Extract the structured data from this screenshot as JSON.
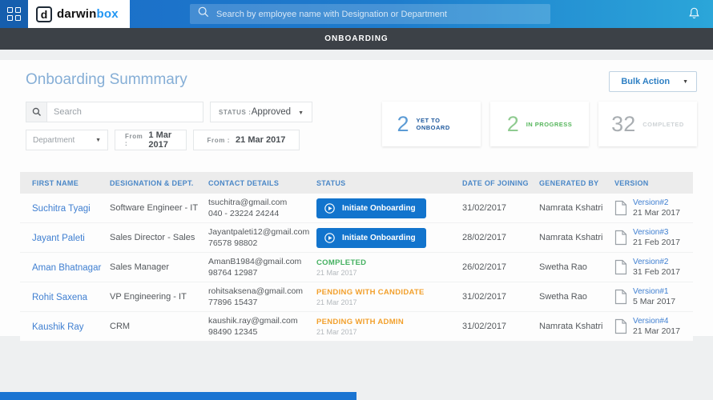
{
  "navbar": {
    "brand_darwin": "darwin",
    "brand_box": "box",
    "brand_initial": "d",
    "search_placeholder": "Search by employee name with Designation or Department"
  },
  "tabbar": {
    "title": "ONBOARDING"
  },
  "page": {
    "title": "Onboarding Summmary",
    "bulk_action_label": "Bulk Action"
  },
  "filters": {
    "search_placeholder": "Search",
    "status_label": "STATUS :",
    "status_value": "Approved",
    "department_placeholder": "Department",
    "from_label": "From :",
    "from_value": "1 Mar 2017",
    "to_label": "From :",
    "to_value": "21 Mar 2017"
  },
  "stats": [
    {
      "value": "2",
      "label": "YET TO ONBOARD",
      "color": "#5b9bd5"
    },
    {
      "value": "2",
      "label": "IN PROGRESS",
      "color": "#8fcb90"
    },
    {
      "value": "32",
      "label": "COMPLETED",
      "color": "#a9aeb2"
    }
  ],
  "table": {
    "headers": [
      "FIRST NAME",
      "DESIGNATION & DEPT.",
      "CONTACT DETAILS",
      "STATUS",
      "DATE OF JOINING",
      "GENERATED BY",
      "VERSION"
    ],
    "status_colors": {
      "completed": "#45b161",
      "pending": "#f2a02c",
      "button": "#1274cd"
    },
    "rows": [
      {
        "name": "Suchitra Tyagi",
        "designation": "Software Engineer - IT",
        "contact_line1": "tsuchitra@gmail.com",
        "contact_line2": "040 - 23224 24244",
        "status_type": "button",
        "status_label": "Initiate Onboarding",
        "doj": "31/02/2017",
        "generated_by": "Namrata Kshatri",
        "version": "Version#2",
        "version_date": "21 Mar 2017"
      },
      {
        "name": "Jayant Paleti",
        "designation": "Sales Director - Sales",
        "contact_line1": "Jayantpaleti12@gmail.com",
        "contact_line2": "76578 98802",
        "status_type": "button",
        "status_label": "Initiate Onboarding",
        "doj": "28/02/2017",
        "generated_by": "Namrata Kshatri",
        "version": "Version#3",
        "version_date": "21 Feb 2017"
      },
      {
        "name": "Aman Bhatnagar",
        "designation": "Sales Manager",
        "contact_line1": "AmanB1984@gmail.com",
        "contact_line2": "98764 12987",
        "status_type": "text",
        "status_label": "COMPLETED",
        "status_color": "#45b161",
        "status_date": "21 Mar 2017",
        "doj": "26/02/2017",
        "generated_by": "Swetha Rao",
        "version": "Version#2",
        "version_date": "31 Feb 2017"
      },
      {
        "name": "Rohit Saxena",
        "designation": "VP Engineering - IT",
        "contact_line1": "rohitsaksena@gmail.com",
        "contact_line2": "77896 15437",
        "status_type": "text",
        "status_label": "PENDING WITH CANDIDATE",
        "status_color": "#f2a02c",
        "status_date": "21 Mar 2017",
        "doj": "31/02/2017",
        "generated_by": "Swetha Rao",
        "version": "Version#1",
        "version_date": "5 Mar 2017"
      },
      {
        "name": "Kaushik Ray",
        "designation": "CRM",
        "contact_line1": "kaushik.ray@gmail.com",
        "contact_line2": "98490 12345",
        "status_type": "text",
        "status_label": "PENDING WITH ADMIN",
        "status_color": "#f2a02c",
        "status_date": "21 Mar 2017",
        "doj": "31/02/2017",
        "generated_by": "Namrata Kshatri",
        "version": "Version#4",
        "version_date": "21 Mar 2017"
      }
    ]
  },
  "icons": {
    "apps-grid": "grid",
    "navbar-search": "magnifier",
    "notifications": "bell",
    "filter-search": "magnifier",
    "status-play": "play-circle",
    "version-doc": "document",
    "dropdown-caret": "caret-down"
  }
}
